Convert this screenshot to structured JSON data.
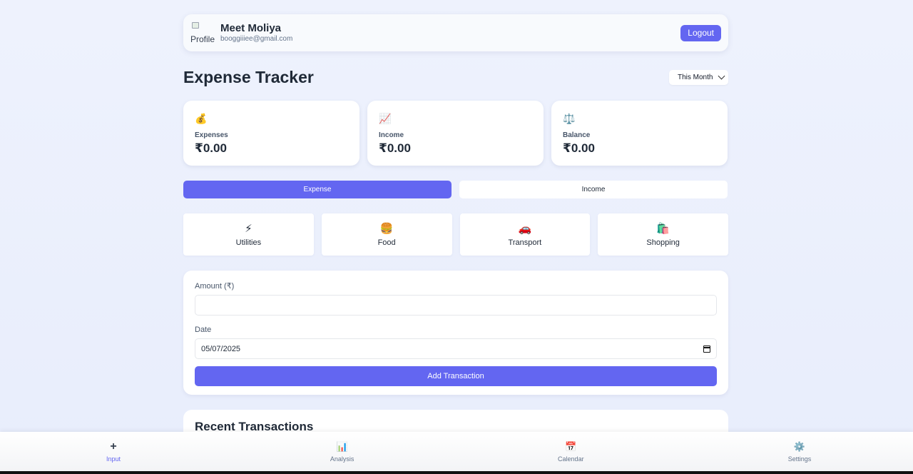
{
  "user": {
    "avatar_alt": "Profile",
    "name": "Meet Moliya",
    "email": "booggiiiee@gmail.com"
  },
  "header": {
    "logout_label": "Logout"
  },
  "page": {
    "title": "Expense Tracker",
    "period": "This Month"
  },
  "stats": [
    {
      "icon": "💰",
      "icon_name": "money-bag-icon",
      "label": "Expenses",
      "value": "₹0.00"
    },
    {
      "icon": "📈",
      "icon_name": "chart-up-icon",
      "label": "Income",
      "value": "₹0.00"
    },
    {
      "icon": "⚖️",
      "icon_name": "scale-icon",
      "label": "Balance",
      "value": "₹0.00"
    }
  ],
  "type_toggle": {
    "expense": "Expense",
    "income": "Income",
    "active": "Expense"
  },
  "categories": [
    {
      "icon": "⚡",
      "icon_name": "lightning-icon",
      "label": "Utilities"
    },
    {
      "icon": "🍔",
      "icon_name": "burger-icon",
      "label": "Food"
    },
    {
      "icon": "🚗",
      "icon_name": "car-icon",
      "label": "Transport"
    },
    {
      "icon": "🛍️",
      "icon_name": "shopping-bags-icon",
      "label": "Shopping"
    }
  ],
  "form": {
    "amount_label": "Amount (₹)",
    "amount_value": "",
    "date_label": "Date",
    "date_value": "05/07/2025",
    "submit_label": "Add Transaction"
  },
  "recent": {
    "title": "Recent Transactions"
  },
  "nav": [
    {
      "icon": "+",
      "icon_name": "plus-icon",
      "label": "Input",
      "active": true
    },
    {
      "icon": "📊",
      "icon_name": "bar-chart-icon",
      "label": "Analysis",
      "active": false
    },
    {
      "icon": "📅",
      "icon_name": "calendar-icon",
      "label": "Calendar",
      "active": false
    },
    {
      "icon": "⚙️",
      "icon_name": "gear-icon",
      "label": "Settings",
      "active": false
    }
  ],
  "colors": {
    "accent": "#6366f1",
    "background": "#eef2fd"
  }
}
